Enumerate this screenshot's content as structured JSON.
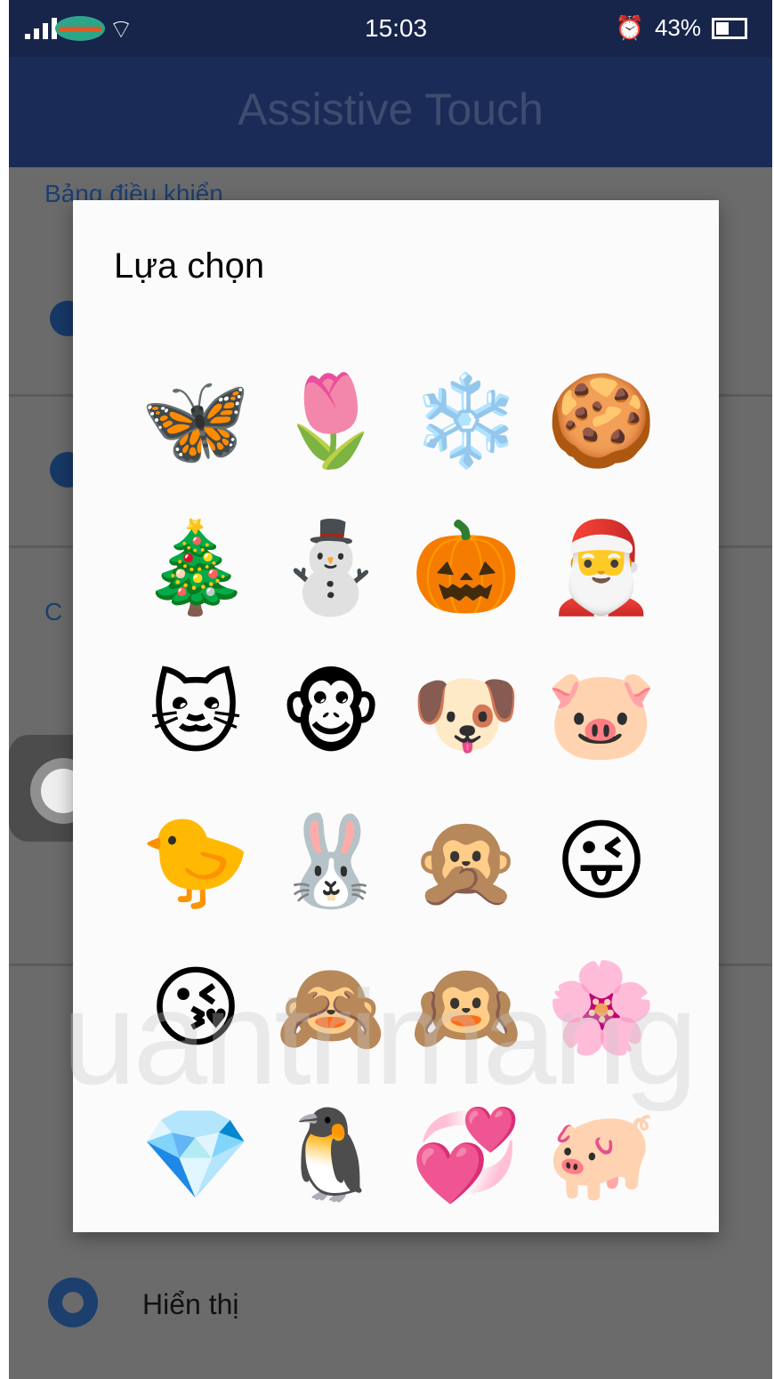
{
  "status_bar": {
    "time": "15:03",
    "battery_percent": "43%"
  },
  "app_bar": {
    "title": "Assistive Touch"
  },
  "background": {
    "section_1": "Bảng điều khiển",
    "section_2": "C",
    "display_label": "Hiển thị"
  },
  "dialog": {
    "title": "Lựa chọn",
    "icons": [
      {
        "name": "butterfly-icon",
        "glyph": "🦋"
      },
      {
        "name": "tulip-icon",
        "glyph": "🌷"
      },
      {
        "name": "snowflake-icon",
        "glyph": "❄️"
      },
      {
        "name": "gingerbread-icon",
        "glyph": "🍪"
      },
      {
        "name": "christmas-tree-icon",
        "glyph": "🎄"
      },
      {
        "name": "snowman-icon",
        "glyph": "⛄"
      },
      {
        "name": "pumpkin-icon",
        "glyph": "🎃"
      },
      {
        "name": "santa-icon",
        "glyph": "🎅"
      },
      {
        "name": "cat-icon",
        "glyph": "🐱"
      },
      {
        "name": "monkey-face-icon",
        "glyph": "🐵"
      },
      {
        "name": "dog-icon",
        "glyph": "🐶"
      },
      {
        "name": "pig-face-icon",
        "glyph": "🐷"
      },
      {
        "name": "chick-icon",
        "glyph": "🐤"
      },
      {
        "name": "rabbit-icon",
        "glyph": "🐰"
      },
      {
        "name": "speak-no-evil-monkey-icon",
        "glyph": "🙊"
      },
      {
        "name": "winking-tongue-icon",
        "glyph": "😜"
      },
      {
        "name": "kiss-icon",
        "glyph": "😘"
      },
      {
        "name": "see-no-evil-monkey-icon",
        "glyph": "🙈"
      },
      {
        "name": "hear-no-evil-monkey-icon",
        "glyph": "🙉"
      },
      {
        "name": "flower-icon",
        "glyph": "🌸"
      },
      {
        "name": "diamond-icon",
        "glyph": "💎"
      },
      {
        "name": "penguin-icon",
        "glyph": "🐧"
      },
      {
        "name": "hearts-icon",
        "glyph": "💞"
      },
      {
        "name": "pig-icon",
        "glyph": "🐖"
      }
    ]
  },
  "watermark": "uantrimang"
}
